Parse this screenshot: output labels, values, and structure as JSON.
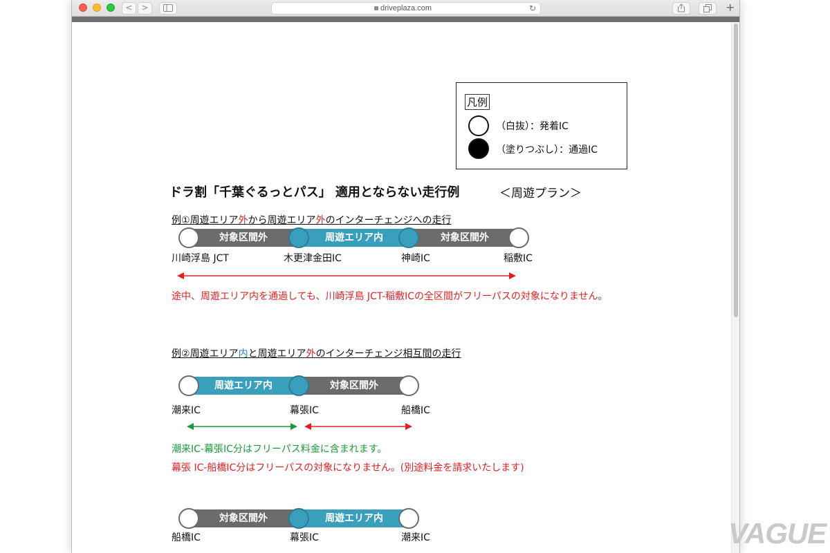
{
  "browser": {
    "url": "driveplaza.com",
    "nav_back": "<",
    "nav_forward": ">",
    "new_tab": "+"
  },
  "legend": {
    "title": "凡例",
    "open_circle_text": "（白抜）：発着IC",
    "filled_circle_text": "（塗りつぶし）：通過IC"
  },
  "page": {
    "title": "ドラ割「千葉ぐるっとパス」 適用とならない走行例",
    "subtitle": "＜周遊プラン＞"
  },
  "example1": {
    "heading_prefix": "例①",
    "heading_part1": "周遊エリア",
    "heading_hl1": "外",
    "heading_part2": "から周遊エリア",
    "heading_hl2": "外",
    "heading_part3": "のインターチェンジへの走行",
    "segments": [
      "対象区間外",
      "周遊エリア内",
      "対象区間外"
    ],
    "ics": [
      "川崎浮島 JCT",
      "木更津金田IC",
      "神崎IC",
      "稲敷IC"
    ],
    "note": "途中、周遊エリア内を通過しても、川崎浮島 JCT-稲敷ICの全区間がフリーパスの対象になりません。"
  },
  "example2": {
    "heading_prefix": "例②",
    "heading_part1": "周遊エリア",
    "heading_hl1": "内",
    "heading_part2": "と周遊エリア",
    "heading_hl2": "外",
    "heading_part3": "のインターチェンジ相互間の走行",
    "segments": [
      "周遊エリア内",
      "対象区間外"
    ],
    "ics": [
      "潮来IC",
      "幕張IC",
      "船橋IC"
    ],
    "note_green": "潮来IC-幕張IC分はフリーパス料金に含まれます。",
    "note_red": "幕張 IC-船橋IC分はフリーパスの対象になりません。(別途料金を請求いたします)"
  },
  "example3": {
    "segments": [
      "対象区間外",
      "周遊エリア内"
    ],
    "ics": [
      "船橋IC",
      "幕張IC",
      "潮来IC"
    ]
  },
  "watermark": "VAGUE",
  "colors": {
    "area_in": "#3a9fbd",
    "area_out": "#6b6b6b",
    "note_red": "#e02020",
    "note_green": "#1a9a3a"
  }
}
